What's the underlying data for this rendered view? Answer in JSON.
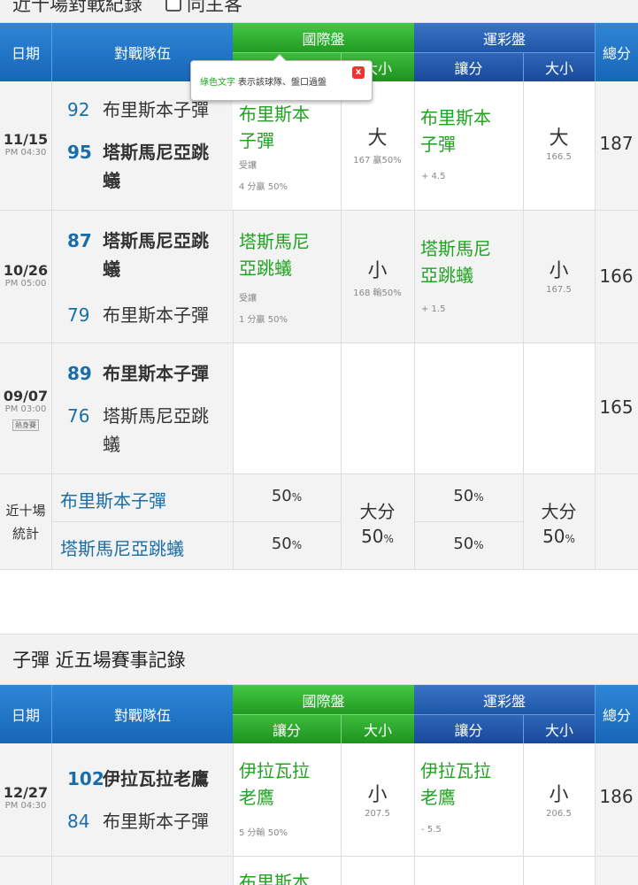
{
  "section1": {
    "title": "近十場對戰紀錄",
    "checkbox_label": "同主客",
    "headers": {
      "date": "日期",
      "teams": "對戰隊伍",
      "intl": "國際盤",
      "lottery": "運彩盤",
      "total": "總分",
      "spread": "讓分",
      "ou": "大小"
    },
    "tooltip": {
      "green": "綠色文字",
      "text": "表示該球隊、盤口過盤",
      "close": "x"
    },
    "rows": [
      {
        "date": "11/15",
        "time": "PM 04:30",
        "t1_score": "92",
        "t1_name": "布里斯本子彈",
        "t2_score": "95",
        "t2_name1": "塔斯馬尼亞跳",
        "t2_name2": "蟻",
        "intl_pick1": "布里斯本",
        "intl_pick2": "子彈",
        "intl_note1": "受讓",
        "intl_note2": "4 分贏 50%",
        "intl_ou": "大",
        "intl_ou_sub": "167 贏50%",
        "lot_pick1": "布里斯本",
        "lot_pick2": "子彈",
        "lot_note": "+ 4.5",
        "lot_ou": "大",
        "lot_ou_sub": "166.5",
        "total": "187"
      },
      {
        "date": "10/26",
        "time": "PM 05:00",
        "t1_score": "87",
        "t1_name1": "塔斯馬尼亞跳",
        "t1_name2": "蟻",
        "t2_score": "79",
        "t2_name": "布里斯本子彈",
        "intl_pick1": "塔斯馬尼",
        "intl_pick2": "亞跳蟻",
        "intl_note1": "受讓",
        "intl_note2": "1 分贏 50%",
        "intl_ou": "小",
        "intl_ou_sub": "168 輸50%",
        "lot_pick1": "塔斯馬尼",
        "lot_pick2": "亞跳蟻",
        "lot_note": "+ 1.5",
        "lot_ou": "小",
        "lot_ou_sub": "167.5",
        "total": "166"
      },
      {
        "date": "09/07",
        "time": "PM 03:00",
        "tag": "熱身賽",
        "t1_score": "89",
        "t1_name": "布里斯本子彈",
        "t2_score": "76",
        "t2_name1": "塔斯馬尼亞跳",
        "t2_name2": "蟻",
        "total": "165"
      }
    ],
    "stats": {
      "label1": "近十場",
      "label2": "統計",
      "team1": "布里斯本子彈",
      "team2": "塔斯馬尼亞跳蟻",
      "t1_intl": "50",
      "t2_intl": "50",
      "intl_ou_label": "大分",
      "intl_ou_pct": "50",
      "t1_lot": "50",
      "t2_lot": "50",
      "lot_ou_label": "大分",
      "lot_ou_pct": "50",
      "pct_sign": "%"
    }
  },
  "section2": {
    "title": "子彈 近五場賽事記錄",
    "rows": [
      {
        "date": "12/27",
        "time": "PM 04:30",
        "t1_score": "102",
        "t1_name": "伊拉瓦拉老鷹",
        "t2_score": "84",
        "t2_name": "布里斯本子彈",
        "intl_pick1": "伊拉瓦拉",
        "intl_pick2": "老鷹",
        "intl_note": "5 分輸 50%",
        "intl_ou": "小",
        "intl_ou_sub": "207.5",
        "lot_pick1": "伊拉瓦拉",
        "lot_pick2": "老鷹",
        "lot_note": "- 5.5",
        "lot_ou": "小",
        "lot_ou_sub": "206.5",
        "total": "186"
      }
    ],
    "partial_pick": "布里斯本"
  }
}
